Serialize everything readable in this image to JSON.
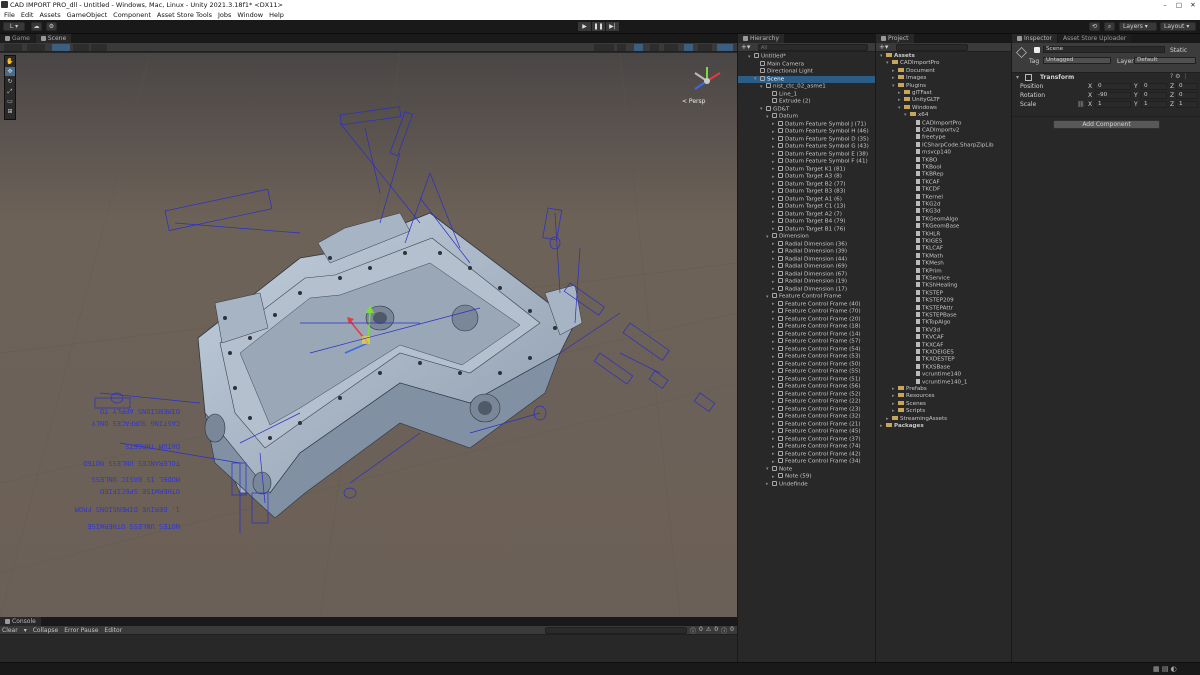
{
  "window": {
    "title": "CAD IMPORT PRO_dll - Untitled - Windows, Mac, Linux - Unity 2021.3.18f1* <DX11>"
  },
  "menu": [
    "File",
    "Edit",
    "Assets",
    "GameObject",
    "Component",
    "Asset Store Tools",
    "Jobs",
    "Window",
    "Help"
  ],
  "toolbar": {
    "account": "L",
    "layers": "Layers",
    "layout": "Layout"
  },
  "scene_panel": {
    "tabs": [
      "Game",
      "Scene"
    ],
    "persp_label": "< Persp"
  },
  "console": {
    "tab": "Console",
    "clear": "Clear",
    "collapse": "Collapse",
    "error_pause": "Error Pause",
    "editor": "Editor",
    "count_info": "0",
    "count_warn": "0",
    "count_err": "0"
  },
  "hierarchy": {
    "tab": "Hierarchy",
    "search_placeholder": "All",
    "items": [
      {
        "label": "Untitled*",
        "depth": 0,
        "fold": "▾"
      },
      {
        "label": "Main Camera",
        "depth": 1,
        "fold": ""
      },
      {
        "label": "Directional Light",
        "depth": 1,
        "fold": ""
      },
      {
        "label": "Scene",
        "depth": 1,
        "fold": "▾",
        "selected": true
      },
      {
        "label": "nist_ctc_02_asme1",
        "depth": 2,
        "fold": "▾"
      },
      {
        "label": "Line_1",
        "depth": 3,
        "fold": ""
      },
      {
        "label": "Extrude (2)",
        "depth": 3,
        "fold": ""
      },
      {
        "label": "GD&T",
        "depth": 2,
        "fold": "▾"
      },
      {
        "label": "Datum",
        "depth": 3,
        "fold": "▾"
      },
      {
        "label": "Datum Feature Symbol J (71)",
        "depth": 4,
        "fold": "▸"
      },
      {
        "label": "Datum Feature Symbol H (46)",
        "depth": 4,
        "fold": "▸"
      },
      {
        "label": "Datum Feature Symbol D (35)",
        "depth": 4,
        "fold": "▸"
      },
      {
        "label": "Datum Feature Symbol G (43)",
        "depth": 4,
        "fold": "▸"
      },
      {
        "label": "Datum Feature Symbol E (38)",
        "depth": 4,
        "fold": "▸"
      },
      {
        "label": "Datum Feature Symbol F (41)",
        "depth": 4,
        "fold": "▸"
      },
      {
        "label": "Datum Target K1 (81)",
        "depth": 4,
        "fold": "▸"
      },
      {
        "label": "Datum Target A3 (8)",
        "depth": 4,
        "fold": "▸"
      },
      {
        "label": "Datum Target B2 (77)",
        "depth": 4,
        "fold": "▸"
      },
      {
        "label": "Datum Target B3 (83)",
        "depth": 4,
        "fold": "▸"
      },
      {
        "label": "Datum Target A1 (6)",
        "depth": 4,
        "fold": "▸"
      },
      {
        "label": "Datum Target C1 (13)",
        "depth": 4,
        "fold": "▸"
      },
      {
        "label": "Datum Target A2 (7)",
        "depth": 4,
        "fold": "▸"
      },
      {
        "label": "Datum Target B4 (79)",
        "depth": 4,
        "fold": "▸"
      },
      {
        "label": "Datum Target B1 (76)",
        "depth": 4,
        "fold": "▸"
      },
      {
        "label": "Dimension",
        "depth": 3,
        "fold": "▾"
      },
      {
        "label": "Radial Dimension (36)",
        "depth": 4,
        "fold": "▸"
      },
      {
        "label": "Radial Dimension (39)",
        "depth": 4,
        "fold": "▸"
      },
      {
        "label": "Radial Dimension (44)",
        "depth": 4,
        "fold": "▸"
      },
      {
        "label": "Radial Dimension (69)",
        "depth": 4,
        "fold": "▸"
      },
      {
        "label": "Radial Dimension (67)",
        "depth": 4,
        "fold": "▸"
      },
      {
        "label": "Radial Dimension (19)",
        "depth": 4,
        "fold": "▸"
      },
      {
        "label": "Radial Dimension (17)",
        "depth": 4,
        "fold": "▸"
      },
      {
        "label": "Feature Control Frame",
        "depth": 3,
        "fold": "▾"
      },
      {
        "label": "Feature Control Frame (40)",
        "depth": 4,
        "fold": "▸"
      },
      {
        "label": "Feature Control Frame (70)",
        "depth": 4,
        "fold": "▸"
      },
      {
        "label": "Feature Control Frame (20)",
        "depth": 4,
        "fold": "▸"
      },
      {
        "label": "Feature Control Frame (18)",
        "depth": 4,
        "fold": "▸"
      },
      {
        "label": "Feature Control Frame (14)",
        "depth": 4,
        "fold": "▸"
      },
      {
        "label": "Feature Control Frame (57)",
        "depth": 4,
        "fold": "▸"
      },
      {
        "label": "Feature Control Frame (54)",
        "depth": 4,
        "fold": "▸"
      },
      {
        "label": "Feature Control Frame (53)",
        "depth": 4,
        "fold": "▸"
      },
      {
        "label": "Feature Control Frame (50)",
        "depth": 4,
        "fold": "▸"
      },
      {
        "label": "Feature Control Frame (55)",
        "depth": 4,
        "fold": "▸"
      },
      {
        "label": "Feature Control Frame (51)",
        "depth": 4,
        "fold": "▸"
      },
      {
        "label": "Feature Control Frame (56)",
        "depth": 4,
        "fold": "▸"
      },
      {
        "label": "Feature Control Frame (52)",
        "depth": 4,
        "fold": "▸"
      },
      {
        "label": "Feature Control Frame (22)",
        "depth": 4,
        "fold": "▸"
      },
      {
        "label": "Feature Control Frame (23)",
        "depth": 4,
        "fold": "▸"
      },
      {
        "label": "Feature Control Frame (32)",
        "depth": 4,
        "fold": "▸"
      },
      {
        "label": "Feature Control Frame (21)",
        "depth": 4,
        "fold": "▸"
      },
      {
        "label": "Feature Control Frame (45)",
        "depth": 4,
        "fold": "▸"
      },
      {
        "label": "Feature Control Frame (37)",
        "depth": 4,
        "fold": "▸"
      },
      {
        "label": "Feature Control Frame (74)",
        "depth": 4,
        "fold": "▸"
      },
      {
        "label": "Feature Control Frame (42)",
        "depth": 4,
        "fold": "▸"
      },
      {
        "label": "Feature Control Frame (34)",
        "depth": 4,
        "fold": "▸"
      },
      {
        "label": "Note",
        "depth": 3,
        "fold": "▾"
      },
      {
        "label": "Note (59)",
        "depth": 4,
        "fold": "▸"
      },
      {
        "label": "Undefinde",
        "depth": 3,
        "fold": "▸"
      }
    ]
  },
  "project": {
    "tab": "Project",
    "items": [
      {
        "label": "Assets",
        "depth": 0,
        "fold": "▾",
        "folder": true,
        "bold": true
      },
      {
        "label": "CADImportPro",
        "depth": 1,
        "fold": "▾",
        "folder": true
      },
      {
        "label": "Document",
        "depth": 2,
        "fold": "▸",
        "folder": true
      },
      {
        "label": "Images",
        "depth": 2,
        "fold": "▸",
        "folder": true
      },
      {
        "label": "Plugins",
        "depth": 2,
        "fold": "▾",
        "folder": true
      },
      {
        "label": "glTFast",
        "depth": 3,
        "fold": "▸",
        "folder": true
      },
      {
        "label": "UnityGLTF",
        "depth": 3,
        "fold": "▸",
        "folder": true
      },
      {
        "label": "Windows",
        "depth": 3,
        "fold": "▾",
        "folder": true
      },
      {
        "label": "x64",
        "depth": 4,
        "fold": "▾",
        "folder": true
      },
      {
        "label": "CADImportPro",
        "depth": 5,
        "fold": "",
        "folder": false
      },
      {
        "label": "CADImportv2",
        "depth": 5,
        "fold": "",
        "folder": false
      },
      {
        "label": "freetype",
        "depth": 5,
        "fold": "",
        "folder": false
      },
      {
        "label": "ICSharpCode.SharpZipLib",
        "depth": 5,
        "fold": "",
        "folder": false
      },
      {
        "label": "msvcp140",
        "depth": 5,
        "fold": "",
        "folder": false
      },
      {
        "label": "TKBO",
        "depth": 5,
        "fold": "",
        "folder": false
      },
      {
        "label": "TKBool",
        "depth": 5,
        "fold": "",
        "folder": false
      },
      {
        "label": "TKBRep",
        "depth": 5,
        "fold": "",
        "folder": false
      },
      {
        "label": "TKCAF",
        "depth": 5,
        "fold": "",
        "folder": false
      },
      {
        "label": "TKCDF",
        "depth": 5,
        "fold": "",
        "folder": false
      },
      {
        "label": "TKernel",
        "depth": 5,
        "fold": "",
        "folder": false
      },
      {
        "label": "TKG2d",
        "depth": 5,
        "fold": "",
        "folder": false
      },
      {
        "label": "TKG3d",
        "depth": 5,
        "fold": "",
        "folder": false
      },
      {
        "label": "TKGeomAlgo",
        "depth": 5,
        "fold": "",
        "folder": false
      },
      {
        "label": "TKGeomBase",
        "depth": 5,
        "fold": "",
        "folder": false
      },
      {
        "label": "TKHLR",
        "depth": 5,
        "fold": "",
        "folder": false
      },
      {
        "label": "TKIGES",
        "depth": 5,
        "fold": "",
        "folder": false
      },
      {
        "label": "TKLCAF",
        "depth": 5,
        "fold": "",
        "folder": false
      },
      {
        "label": "TKMath",
        "depth": 5,
        "fold": "",
        "folder": false
      },
      {
        "label": "TKMesh",
        "depth": 5,
        "fold": "",
        "folder": false
      },
      {
        "label": "TKPrim",
        "depth": 5,
        "fold": "",
        "folder": false
      },
      {
        "label": "TKService",
        "depth": 5,
        "fold": "",
        "folder": false
      },
      {
        "label": "TKShHealing",
        "depth": 5,
        "fold": "",
        "folder": false
      },
      {
        "label": "TKSTEP",
        "depth": 5,
        "fold": "",
        "folder": false
      },
      {
        "label": "TKSTEP209",
        "depth": 5,
        "fold": "",
        "folder": false
      },
      {
        "label": "TKSTEPAttr",
        "depth": 5,
        "fold": "",
        "folder": false
      },
      {
        "label": "TKSTEPBase",
        "depth": 5,
        "fold": "",
        "folder": false
      },
      {
        "label": "TKTopAlgo",
        "depth": 5,
        "fold": "",
        "folder": false
      },
      {
        "label": "TKV3d",
        "depth": 5,
        "fold": "",
        "folder": false
      },
      {
        "label": "TKVCAF",
        "depth": 5,
        "fold": "",
        "folder": false
      },
      {
        "label": "TKXCAF",
        "depth": 5,
        "fold": "",
        "folder": false
      },
      {
        "label": "TKXDEIGES",
        "depth": 5,
        "fold": "",
        "folder": false
      },
      {
        "label": "TKXDESTEP",
        "depth": 5,
        "fold": "",
        "folder": false
      },
      {
        "label": "TKXSBase",
        "depth": 5,
        "fold": "",
        "folder": false
      },
      {
        "label": "vcruntime140",
        "depth": 5,
        "fold": "",
        "folder": false
      },
      {
        "label": "vcruntime140_1",
        "depth": 5,
        "fold": "",
        "folder": false
      },
      {
        "label": "Prefabs",
        "depth": 2,
        "fold": "▸",
        "folder": true
      },
      {
        "label": "Resources",
        "depth": 2,
        "fold": "▸",
        "folder": true
      },
      {
        "label": "Scenes",
        "depth": 2,
        "fold": "▸",
        "folder": true
      },
      {
        "label": "Scripts",
        "depth": 2,
        "fold": "▸",
        "folder": true
      },
      {
        "label": "StreamingAssets",
        "depth": 1,
        "fold": "▸",
        "folder": true
      },
      {
        "label": "Packages",
        "depth": 0,
        "fold": "▸",
        "folder": true,
        "bold": true
      }
    ]
  },
  "inspector": {
    "tabs": [
      "Inspector",
      "Asset Store Uploader"
    ],
    "object_name": "Scene",
    "static_label": "Static",
    "tag_label": "Tag",
    "tag_value": "Untagged",
    "layer_label": "Layer",
    "layer_value": "Default",
    "component_title": "Transform",
    "position_label": "Position",
    "rotation_label": "Rotation",
    "scale_label": "Scale",
    "position": {
      "x": "0",
      "y": "0",
      "z": "0"
    },
    "rotation": {
      "x": "-90",
      "y": "0",
      "z": "0"
    },
    "scale": {
      "x": "1",
      "y": "1",
      "z": "1"
    },
    "add_component": "Add Component"
  },
  "colors": {
    "selection": "#2c5d87",
    "annotation": "#2a2ec8",
    "model": "#a9b7c9",
    "panel": "#282828"
  }
}
